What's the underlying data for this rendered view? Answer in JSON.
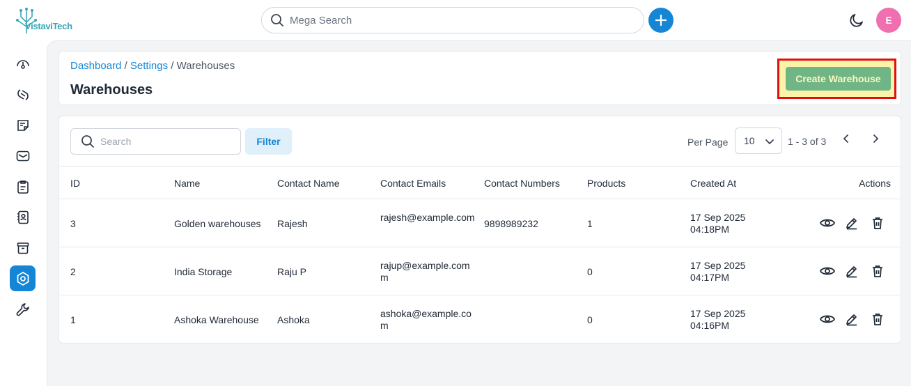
{
  "app": {
    "logo_text": "VistaviTech"
  },
  "topbar": {
    "search_placeholder": "Mega Search",
    "avatar_initial": "E"
  },
  "sidebar": {
    "items": [
      {
        "icon": "gauge-icon"
      },
      {
        "icon": "integrations-icon"
      },
      {
        "icon": "sticky-note-icon"
      },
      {
        "icon": "mail-icon"
      },
      {
        "icon": "clipboard-icon"
      },
      {
        "icon": "contacts-icon"
      },
      {
        "icon": "archive-icon"
      },
      {
        "icon": "settings-hex-icon",
        "active": true
      },
      {
        "icon": "wrench-icon"
      }
    ]
  },
  "header": {
    "breadcrumb": {
      "dashboard": "Dashboard",
      "sep1": " / ",
      "settings": "Settings",
      "sep2": " / ",
      "current": "Warehouses"
    },
    "title": "Warehouses",
    "create_label": "Create Warehouse"
  },
  "toolbar": {
    "search_placeholder": "Search",
    "filter_label": "Filter",
    "per_page_label": "Per Page",
    "per_page_value": "10",
    "range_text": "1 - 3 of 3"
  },
  "table": {
    "columns": [
      "ID",
      "Name",
      "Contact Name",
      "Contact Emails",
      "Contact Numbers",
      "Products",
      "Created At",
      "Actions"
    ],
    "rows": [
      {
        "id": "3",
        "name": "Golden warehouses",
        "contact_name": "Rajesh",
        "email": "rajesh@example.com",
        "phone": "9898989232",
        "products": "1",
        "date": "17 Sep 2025",
        "time": "04:18PM"
      },
      {
        "id": "2",
        "name": "India Storage",
        "contact_name": "Raju P",
        "email": "rajup@example.comm",
        "phone": "",
        "products": "0",
        "date": "17 Sep 2025",
        "time": "04:17PM"
      },
      {
        "id": "1",
        "name": "Ashoka Warehouse",
        "contact_name": "Ashoka",
        "email": "ashoka@example.com",
        "phone": "",
        "products": "0",
        "date": "17 Sep 2025",
        "time": "04:16PM"
      }
    ]
  },
  "colors": {
    "primary": "#1586d6",
    "create_button": "#6fb586",
    "highlight_border": "#e01010",
    "avatar": "#f06fb0"
  }
}
